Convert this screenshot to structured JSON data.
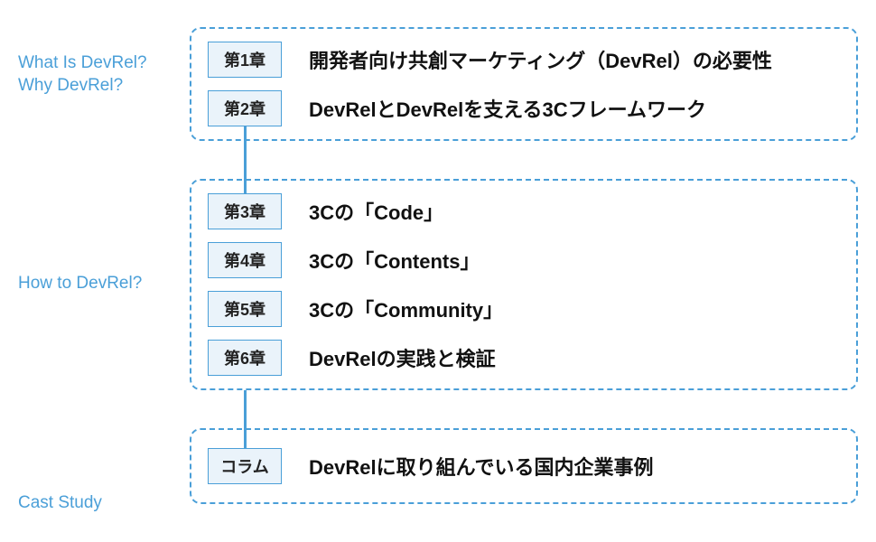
{
  "labels": {
    "section1_line1": "What Is DevRel?",
    "section1_line2": "Why DevRel?",
    "section2": "How to DevRel?",
    "section3": "Cast Study"
  },
  "sections": [
    {
      "rows": [
        {
          "box": "第1章",
          "title": "開発者向け共創マーケティング（DevRel）の必要性"
        },
        {
          "box": "第2章",
          "title": "DevRelとDevRelを支える3Cフレームワーク"
        }
      ]
    },
    {
      "rows": [
        {
          "box": "第3章",
          "title": "3Cの「Code」"
        },
        {
          "box": "第4章",
          "title": "3Cの「Contents」"
        },
        {
          "box": "第5章",
          "title": "3Cの「Community」"
        },
        {
          "box": "第6章",
          "title": "DevRelの実践と検証"
        }
      ]
    },
    {
      "rows": [
        {
          "box": "コラム",
          "title": "DevRelに取り組んでいる国内企業事例"
        }
      ]
    }
  ]
}
